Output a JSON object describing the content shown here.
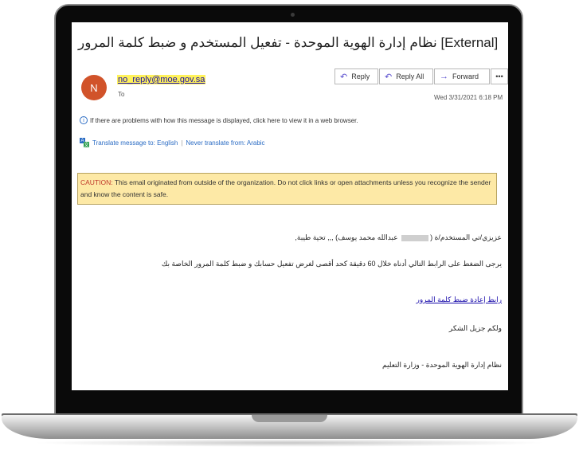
{
  "email": {
    "subject": "نظام إدارة الهوية الموحدة - تفعيل المستخدم و ضبط كلمة المرور [External]",
    "avatar_initial": "N",
    "sender": "no_reply@moe.gov.sa",
    "to_label": "To",
    "date": "Wed 3/31/2021 6:18 PM",
    "actions": {
      "reply": "Reply",
      "reply_all": "Reply All",
      "forward": "Forward",
      "more": "•••"
    },
    "info_bar": "If there are problems with how this message is displayed, click here to view it in a web browser.",
    "translate": {
      "translate_link": "Translate message to: English",
      "separator": "|",
      "never_link": "Never translate from: Arabic"
    },
    "caution": {
      "label": "CAUTION:",
      "text": " This email originated from outside of the organization. Do not click links or open attachments unless you recognize the sender and know the content is safe."
    },
    "body": {
      "greeting_start": "عزيزي/تي المستخدم/ة (",
      "greeting_end": " عبدالله محمد يوسف) ,,, تحية طيبة,",
      "instruction": "يرجى الضغط على الرابط التالي أدناه خلال 60 دقيقة كحد أقصى لغرض تفعيل حسابك و ضبط كلمة المرور الخاصة بك",
      "reset_link": "رابط إعادة ضبط كلمة المرور",
      "thanks": "ولكم جزيل الشكر",
      "signature": "نظام إدارة الهوية الموحدة - وزارة التعليم"
    }
  },
  "colors": {
    "avatar": "#d1532a",
    "sender_highlight": "#fff25a",
    "caution_bg": "#fde9a6",
    "link": "#1a0dab"
  }
}
